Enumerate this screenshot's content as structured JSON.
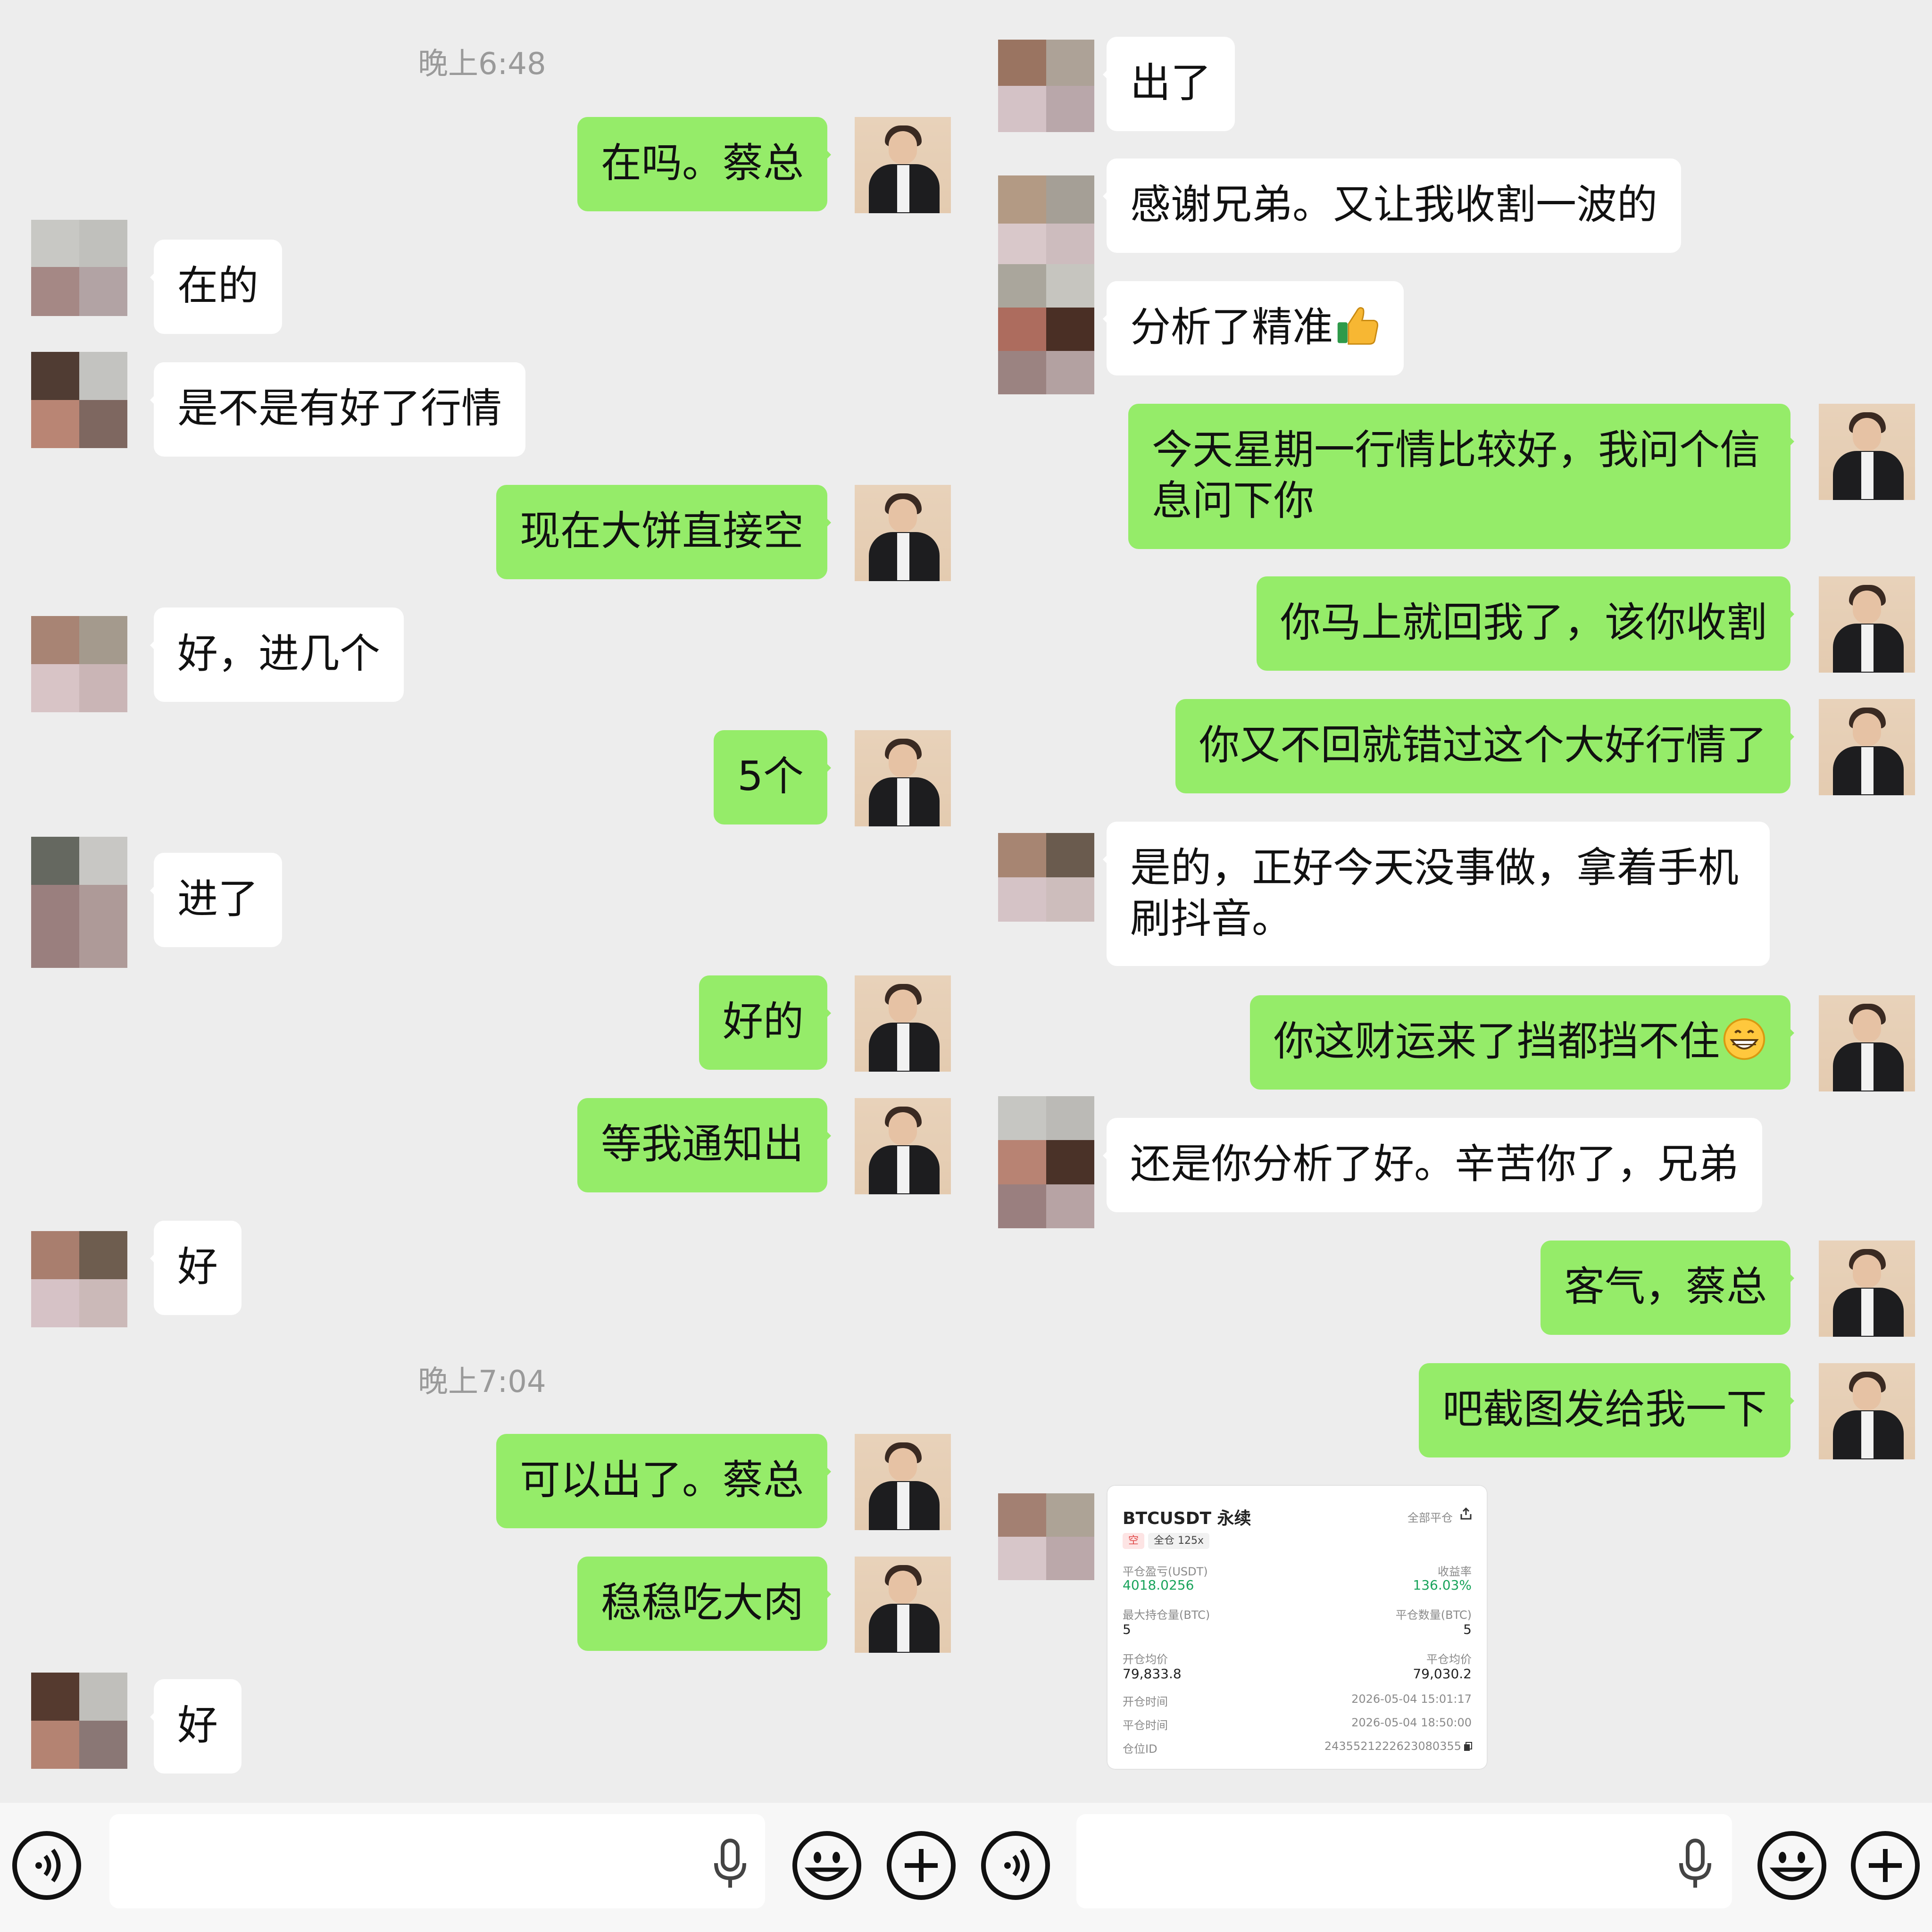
{
  "left": {
    "timestamps": [
      "晚上6:48",
      "晚上7:04"
    ],
    "messages": [
      {
        "side": "out",
        "text": "在吗。蔡总"
      },
      {
        "side": "in",
        "text": "在的"
      },
      {
        "side": "in",
        "text": "是不是有好了行情"
      },
      {
        "side": "out",
        "text": "现在大饼直接空"
      },
      {
        "side": "in",
        "text": "好，进几个"
      },
      {
        "side": "out",
        "text": "5个"
      },
      {
        "side": "in",
        "text": "进了"
      },
      {
        "side": "out",
        "text": "好的"
      },
      {
        "side": "out",
        "text": "等我通知出"
      },
      {
        "side": "in",
        "text": "好"
      },
      {
        "side": "out",
        "text": "可以出了。蔡总"
      },
      {
        "side": "out",
        "text": "稳稳吃大肉"
      },
      {
        "side": "in",
        "text": "好"
      }
    ]
  },
  "right": {
    "messages": [
      {
        "side": "in",
        "text": "出了"
      },
      {
        "side": "in",
        "text": "感谢兄弟。又让我收割一波的"
      },
      {
        "side": "in",
        "text": "分析了精准",
        "emoji": "thumbs-up"
      },
      {
        "side": "out",
        "text": "今天星期一行情比较好，我问个信息问下你"
      },
      {
        "side": "out",
        "text": "你马上就回我了，该你收割"
      },
      {
        "side": "out",
        "text": "你又不回就错过这个大好行情了"
      },
      {
        "side": "in",
        "text": "是的，正好今天没事做，拿着手机刷抖音。"
      },
      {
        "side": "out",
        "text": "你这财运来了挡都挡不住",
        "emoji": "grin"
      },
      {
        "side": "in",
        "text": "还是你分析了好。辛苦你了，兄弟"
      },
      {
        "side": "out",
        "text": "客气，蔡总"
      },
      {
        "side": "out",
        "text": "吧截图发给我一下"
      }
    ]
  },
  "trade_card": {
    "title": "BTCUSDT 永续",
    "close_all": "全部平仓",
    "side_tag": "空",
    "margin_tag": "全仓 125x",
    "pnl_label": "平仓盈亏(USDT)",
    "pnl_value": "4018.0256",
    "roi_label": "收益率",
    "roi_value": "136.03%",
    "max_pos_label": "最大持仓量(BTC)",
    "max_pos_value": "5",
    "close_qty_label": "平仓数量(BTC)",
    "close_qty_value": "5",
    "open_avg_label": "开仓均价",
    "open_avg_value": "79,833.8",
    "close_avg_label": "平仓均价",
    "close_avg_value": "79,030.2",
    "open_time_label": "开仓时间",
    "open_time_value": "2026-05-04 15:01:17",
    "close_time_label": "平仓时间",
    "close_time_value": "2026-05-04 18:50:00",
    "pos_id_label": "仓位ID",
    "pos_id_value": "2435521222623080355"
  },
  "input_bar": {
    "icons": [
      "voice-icon",
      "microphone-icon",
      "emoji-icon",
      "plus-icon"
    ]
  },
  "colors": {
    "outgoing_bubble": "#95ec69",
    "incoming_bubble": "#ffffff",
    "background": "#ededed",
    "profit_green": "#19a35b"
  }
}
